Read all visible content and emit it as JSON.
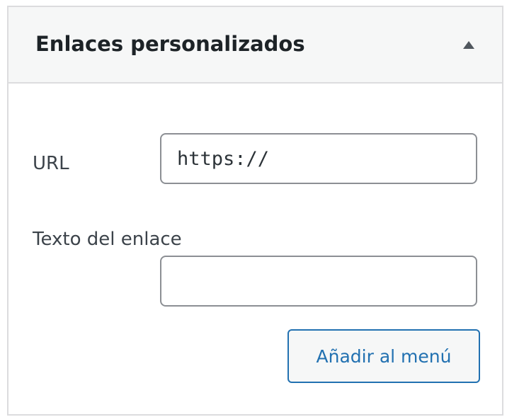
{
  "panel": {
    "title": "Enlaces personalizados",
    "toggle_icon": "triangle-up-icon"
  },
  "form": {
    "url_label": "URL",
    "url_value": "https://",
    "link_text_label": "Texto del enlace",
    "link_text_value": "",
    "add_button_label": "Añadir al menú"
  },
  "colors": {
    "header_background": "#f6f7f7",
    "border": "#dcdcde",
    "input_border": "#8c8f94",
    "accent": "#2271b1",
    "icon": "#50575e"
  }
}
